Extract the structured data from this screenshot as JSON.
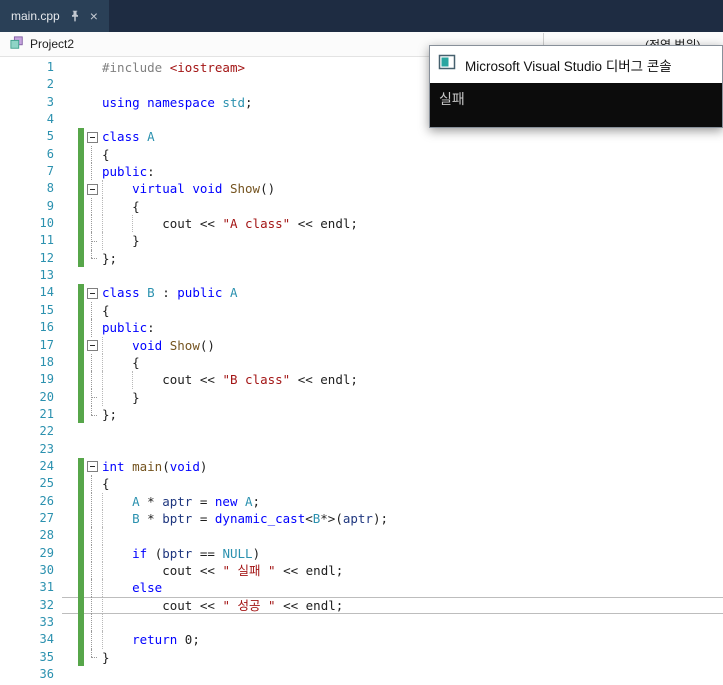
{
  "tab_bar": {
    "tab_label": "main.cpp",
    "close_glyph": "×"
  },
  "nav_bar": {
    "project": "Project2",
    "scope": "(전역 범위)"
  },
  "debug_console": {
    "title": "Microsoft Visual Studio 디버그 콘솔",
    "output": "실패"
  },
  "colors": {
    "keyword": "#0000ff",
    "type": "#2b91af",
    "string": "#a31515",
    "function": "#74531f",
    "macro": "#2b91af",
    "local_variable": "#1f377f",
    "preprocessor": "#808080",
    "line_number": "#2b91af",
    "change_bar": "#57a64a",
    "tab_bar_bg": "#1e2c42",
    "console_bg": "#0c0c0c"
  },
  "editor": {
    "current_line": 32,
    "lines": [
      {
        "n": 1,
        "tokens": [
          [
            "pp",
            "#include "
          ],
          [
            "str",
            "<iostream>"
          ]
        ]
      },
      {
        "n": 2
      },
      {
        "n": 3,
        "tokens": [
          [
            "kw",
            "using namespace "
          ],
          [
            "ns",
            "std"
          ],
          [
            "pl",
            ";"
          ]
        ]
      },
      {
        "n": 4
      },
      {
        "n": 5,
        "changed": true,
        "fold": "box",
        "tokens": [
          [
            "kw",
            "class "
          ],
          [
            "ty",
            "A"
          ]
        ]
      },
      {
        "n": 6,
        "changed": true,
        "fold": "v",
        "tokens": [
          [
            "pl",
            "{"
          ]
        ]
      },
      {
        "n": 7,
        "changed": true,
        "fold": "v",
        "tokens": [
          [
            "kw",
            "public"
          ],
          [
            "pl",
            ":"
          ]
        ]
      },
      {
        "n": 8,
        "changed": true,
        "fold": "box",
        "indent": 1,
        "guides": [
          0
        ],
        "tokens": [
          [
            "kw",
            "virtual void "
          ],
          [
            "fn",
            "Show"
          ],
          [
            "pl",
            "()"
          ]
        ]
      },
      {
        "n": 9,
        "changed": true,
        "fold": "v",
        "indent": 1,
        "guides": [
          0
        ],
        "tokens": [
          [
            "pl",
            "{"
          ]
        ]
      },
      {
        "n": 10,
        "changed": true,
        "fold": "v",
        "indent": 2,
        "guides": [
          0,
          4
        ],
        "tokens": [
          [
            "pl",
            "cout << "
          ],
          [
            "str",
            "\"A class\""
          ],
          [
            "pl",
            " << endl;"
          ]
        ]
      },
      {
        "n": 11,
        "changed": true,
        "fold": "vt",
        "indent": 1,
        "guides": [
          0
        ],
        "tokens": [
          [
            "pl",
            "}"
          ]
        ]
      },
      {
        "n": 12,
        "changed": true,
        "fold": "end",
        "tokens": [
          [
            "pl",
            "};"
          ]
        ]
      },
      {
        "n": 13
      },
      {
        "n": 14,
        "changed": true,
        "fold": "box",
        "tokens": [
          [
            "kw",
            "class "
          ],
          [
            "ty",
            "B"
          ],
          [
            "pl",
            " : "
          ],
          [
            "kw",
            "public "
          ],
          [
            "ty",
            "A"
          ]
        ]
      },
      {
        "n": 15,
        "changed": true,
        "fold": "v",
        "tokens": [
          [
            "pl",
            "{"
          ]
        ]
      },
      {
        "n": 16,
        "changed": true,
        "fold": "v",
        "tokens": [
          [
            "kw",
            "public"
          ],
          [
            "pl",
            ":"
          ]
        ]
      },
      {
        "n": 17,
        "changed": true,
        "fold": "box",
        "indent": 1,
        "guides": [
          0
        ],
        "tokens": [
          [
            "kw",
            "void "
          ],
          [
            "fn",
            "Show"
          ],
          [
            "pl",
            "()"
          ]
        ]
      },
      {
        "n": 18,
        "changed": true,
        "fold": "v",
        "indent": 1,
        "guides": [
          0
        ],
        "tokens": [
          [
            "pl",
            "{"
          ]
        ]
      },
      {
        "n": 19,
        "changed": true,
        "fold": "v",
        "indent": 2,
        "guides": [
          0,
          4
        ],
        "tokens": [
          [
            "pl",
            "cout << "
          ],
          [
            "str",
            "\"B class\""
          ],
          [
            "pl",
            " << endl;"
          ]
        ]
      },
      {
        "n": 20,
        "changed": true,
        "fold": "vt",
        "indent": 1,
        "guides": [
          0
        ],
        "tokens": [
          [
            "pl",
            "}"
          ]
        ]
      },
      {
        "n": 21,
        "changed": true,
        "fold": "end",
        "tokens": [
          [
            "pl",
            "};"
          ]
        ]
      },
      {
        "n": 22
      },
      {
        "n": 23
      },
      {
        "n": 24,
        "changed": true,
        "fold": "box",
        "tokens": [
          [
            "kw",
            "int "
          ],
          [
            "fn",
            "main"
          ],
          [
            "pl",
            "("
          ],
          [
            "kw",
            "void"
          ],
          [
            "pl",
            ")"
          ]
        ]
      },
      {
        "n": 25,
        "changed": true,
        "fold": "v",
        "tokens": [
          [
            "pl",
            "{"
          ]
        ]
      },
      {
        "n": 26,
        "changed": true,
        "fold": "v",
        "indent": 1,
        "guides": [
          0
        ],
        "tokens": [
          [
            "ty",
            "A"
          ],
          [
            "pl",
            " * "
          ],
          [
            "lv",
            "aptr"
          ],
          [
            "pl",
            " = "
          ],
          [
            "kw",
            "new "
          ],
          [
            "ty",
            "A"
          ],
          [
            "pl",
            ";"
          ]
        ]
      },
      {
        "n": 27,
        "changed": true,
        "fold": "v",
        "indent": 1,
        "guides": [
          0
        ],
        "tokens": [
          [
            "ty",
            "B"
          ],
          [
            "pl",
            " * "
          ],
          [
            "lv",
            "bptr"
          ],
          [
            "pl",
            " = "
          ],
          [
            "kw",
            "dynamic_cast"
          ],
          [
            "pl",
            "<"
          ],
          [
            "ty",
            "B"
          ],
          [
            "pl",
            "*>("
          ],
          [
            "lv",
            "aptr"
          ],
          [
            "pl",
            ");"
          ]
        ]
      },
      {
        "n": 28,
        "changed": true,
        "fold": "v",
        "guides": [
          0
        ]
      },
      {
        "n": 29,
        "changed": true,
        "fold": "v",
        "indent": 1,
        "guides": [
          0
        ],
        "tokens": [
          [
            "kw",
            "if"
          ],
          [
            "pl",
            " ("
          ],
          [
            "lv",
            "bptr"
          ],
          [
            "pl",
            " == "
          ],
          [
            "mac",
            "NULL"
          ],
          [
            "pl",
            ")"
          ]
        ]
      },
      {
        "n": 30,
        "changed": true,
        "fold": "v",
        "indent": 2,
        "guides": [
          0
        ],
        "tokens": [
          [
            "pl",
            "cout << "
          ],
          [
            "str",
            "\" 실패 \""
          ],
          [
            "pl",
            " << endl;"
          ]
        ]
      },
      {
        "n": 31,
        "changed": true,
        "fold": "v",
        "indent": 1,
        "guides": [
          0
        ],
        "tokens": [
          [
            "kw",
            "else"
          ]
        ]
      },
      {
        "n": 32,
        "changed": true,
        "fold": "v",
        "indent": 2,
        "guides": [
          0
        ],
        "tokens": [
          [
            "pl",
            "cout << "
          ],
          [
            "str",
            "\" 성공 \""
          ],
          [
            "pl",
            " << endl;"
          ]
        ]
      },
      {
        "n": 33,
        "changed": true,
        "fold": "v",
        "guides": [
          0
        ]
      },
      {
        "n": 34,
        "changed": true,
        "fold": "v",
        "indent": 1,
        "guides": [
          0
        ],
        "tokens": [
          [
            "kw",
            "return"
          ],
          [
            "pl",
            " 0;"
          ]
        ]
      },
      {
        "n": 35,
        "changed": true,
        "fold": "end",
        "tokens": [
          [
            "pl",
            "}"
          ]
        ]
      },
      {
        "n": 36
      }
    ]
  }
}
